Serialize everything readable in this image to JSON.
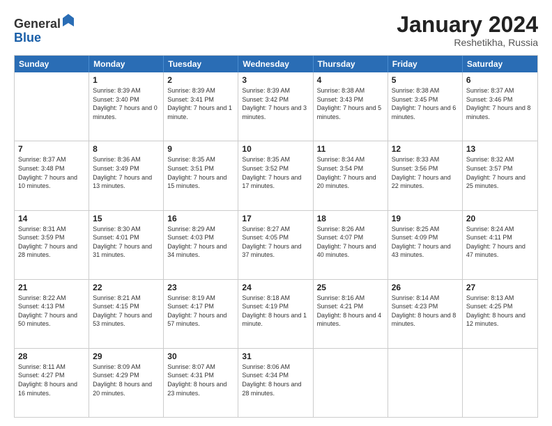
{
  "header": {
    "logo_general": "General",
    "logo_blue": "Blue",
    "month_title": "January 2024",
    "location": "Reshetikha, Russia"
  },
  "weekdays": [
    "Sunday",
    "Monday",
    "Tuesday",
    "Wednesday",
    "Thursday",
    "Friday",
    "Saturday"
  ],
  "rows": [
    [
      {
        "day": "",
        "sunrise": "",
        "sunset": "",
        "daylight": ""
      },
      {
        "day": "1",
        "sunrise": "Sunrise: 8:39 AM",
        "sunset": "Sunset: 3:40 PM",
        "daylight": "Daylight: 7 hours and 0 minutes."
      },
      {
        "day": "2",
        "sunrise": "Sunrise: 8:39 AM",
        "sunset": "Sunset: 3:41 PM",
        "daylight": "Daylight: 7 hours and 1 minute."
      },
      {
        "day": "3",
        "sunrise": "Sunrise: 8:39 AM",
        "sunset": "Sunset: 3:42 PM",
        "daylight": "Daylight: 7 hours and 3 minutes."
      },
      {
        "day": "4",
        "sunrise": "Sunrise: 8:38 AM",
        "sunset": "Sunset: 3:43 PM",
        "daylight": "Daylight: 7 hours and 5 minutes."
      },
      {
        "day": "5",
        "sunrise": "Sunrise: 8:38 AM",
        "sunset": "Sunset: 3:45 PM",
        "daylight": "Daylight: 7 hours and 6 minutes."
      },
      {
        "day": "6",
        "sunrise": "Sunrise: 8:37 AM",
        "sunset": "Sunset: 3:46 PM",
        "daylight": "Daylight: 7 hours and 8 minutes."
      }
    ],
    [
      {
        "day": "7",
        "sunrise": "Sunrise: 8:37 AM",
        "sunset": "Sunset: 3:48 PM",
        "daylight": "Daylight: 7 hours and 10 minutes."
      },
      {
        "day": "8",
        "sunrise": "Sunrise: 8:36 AM",
        "sunset": "Sunset: 3:49 PM",
        "daylight": "Daylight: 7 hours and 13 minutes."
      },
      {
        "day": "9",
        "sunrise": "Sunrise: 8:35 AM",
        "sunset": "Sunset: 3:51 PM",
        "daylight": "Daylight: 7 hours and 15 minutes."
      },
      {
        "day": "10",
        "sunrise": "Sunrise: 8:35 AM",
        "sunset": "Sunset: 3:52 PM",
        "daylight": "Daylight: 7 hours and 17 minutes."
      },
      {
        "day": "11",
        "sunrise": "Sunrise: 8:34 AM",
        "sunset": "Sunset: 3:54 PM",
        "daylight": "Daylight: 7 hours and 20 minutes."
      },
      {
        "day": "12",
        "sunrise": "Sunrise: 8:33 AM",
        "sunset": "Sunset: 3:56 PM",
        "daylight": "Daylight: 7 hours and 22 minutes."
      },
      {
        "day": "13",
        "sunrise": "Sunrise: 8:32 AM",
        "sunset": "Sunset: 3:57 PM",
        "daylight": "Daylight: 7 hours and 25 minutes."
      }
    ],
    [
      {
        "day": "14",
        "sunrise": "Sunrise: 8:31 AM",
        "sunset": "Sunset: 3:59 PM",
        "daylight": "Daylight: 7 hours and 28 minutes."
      },
      {
        "day": "15",
        "sunrise": "Sunrise: 8:30 AM",
        "sunset": "Sunset: 4:01 PM",
        "daylight": "Daylight: 7 hours and 31 minutes."
      },
      {
        "day": "16",
        "sunrise": "Sunrise: 8:29 AM",
        "sunset": "Sunset: 4:03 PM",
        "daylight": "Daylight: 7 hours and 34 minutes."
      },
      {
        "day": "17",
        "sunrise": "Sunrise: 8:27 AM",
        "sunset": "Sunset: 4:05 PM",
        "daylight": "Daylight: 7 hours and 37 minutes."
      },
      {
        "day": "18",
        "sunrise": "Sunrise: 8:26 AM",
        "sunset": "Sunset: 4:07 PM",
        "daylight": "Daylight: 7 hours and 40 minutes."
      },
      {
        "day": "19",
        "sunrise": "Sunrise: 8:25 AM",
        "sunset": "Sunset: 4:09 PM",
        "daylight": "Daylight: 7 hours and 43 minutes."
      },
      {
        "day": "20",
        "sunrise": "Sunrise: 8:24 AM",
        "sunset": "Sunset: 4:11 PM",
        "daylight": "Daylight: 7 hours and 47 minutes."
      }
    ],
    [
      {
        "day": "21",
        "sunrise": "Sunrise: 8:22 AM",
        "sunset": "Sunset: 4:13 PM",
        "daylight": "Daylight: 7 hours and 50 minutes."
      },
      {
        "day": "22",
        "sunrise": "Sunrise: 8:21 AM",
        "sunset": "Sunset: 4:15 PM",
        "daylight": "Daylight: 7 hours and 53 minutes."
      },
      {
        "day": "23",
        "sunrise": "Sunrise: 8:19 AM",
        "sunset": "Sunset: 4:17 PM",
        "daylight": "Daylight: 7 hours and 57 minutes."
      },
      {
        "day": "24",
        "sunrise": "Sunrise: 8:18 AM",
        "sunset": "Sunset: 4:19 PM",
        "daylight": "Daylight: 8 hours and 1 minute."
      },
      {
        "day": "25",
        "sunrise": "Sunrise: 8:16 AM",
        "sunset": "Sunset: 4:21 PM",
        "daylight": "Daylight: 8 hours and 4 minutes."
      },
      {
        "day": "26",
        "sunrise": "Sunrise: 8:14 AM",
        "sunset": "Sunset: 4:23 PM",
        "daylight": "Daylight: 8 hours and 8 minutes."
      },
      {
        "day": "27",
        "sunrise": "Sunrise: 8:13 AM",
        "sunset": "Sunset: 4:25 PM",
        "daylight": "Daylight: 8 hours and 12 minutes."
      }
    ],
    [
      {
        "day": "28",
        "sunrise": "Sunrise: 8:11 AM",
        "sunset": "Sunset: 4:27 PM",
        "daylight": "Daylight: 8 hours and 16 minutes."
      },
      {
        "day": "29",
        "sunrise": "Sunrise: 8:09 AM",
        "sunset": "Sunset: 4:29 PM",
        "daylight": "Daylight: 8 hours and 20 minutes."
      },
      {
        "day": "30",
        "sunrise": "Sunrise: 8:07 AM",
        "sunset": "Sunset: 4:31 PM",
        "daylight": "Daylight: 8 hours and 23 minutes."
      },
      {
        "day": "31",
        "sunrise": "Sunrise: 8:06 AM",
        "sunset": "Sunset: 4:34 PM",
        "daylight": "Daylight: 8 hours and 28 minutes."
      },
      {
        "day": "",
        "sunrise": "",
        "sunset": "",
        "daylight": ""
      },
      {
        "day": "",
        "sunrise": "",
        "sunset": "",
        "daylight": ""
      },
      {
        "day": "",
        "sunrise": "",
        "sunset": "",
        "daylight": ""
      }
    ]
  ]
}
